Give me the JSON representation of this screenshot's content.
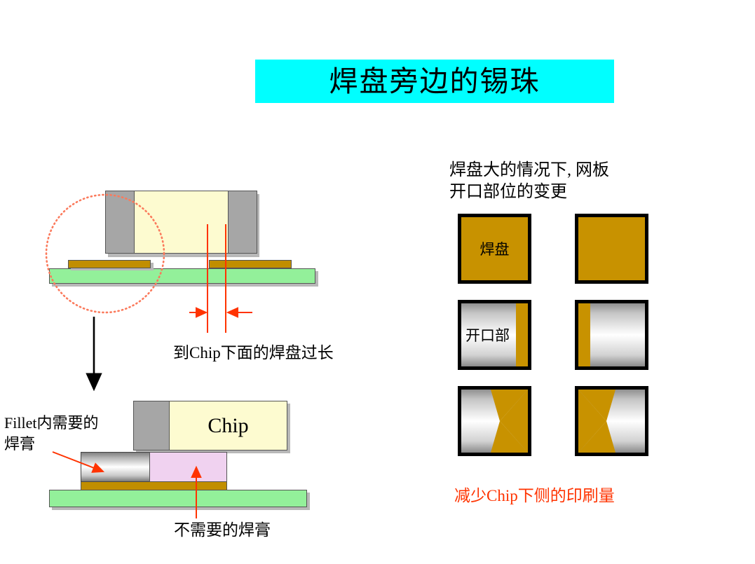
{
  "slide": {
    "title": "焊盘旁边的锡珠",
    "title_bg": "#00ffff"
  },
  "left_panel": {
    "top_diagram": {
      "caption": "到Chip下面的焊盘过长",
      "parts": {
        "chip_body_label": "",
        "pcb_color": "#93f09a",
        "pad_color": "#c18e00",
        "chip_cap_color": "#a6a6a6",
        "chip_core_color": "#fdfbd0",
        "highlight_circle_color": "#ff6347"
      }
    },
    "bottom_diagram": {
      "chip_label": "Chip",
      "fillet_note_line1": "Fillet内需要的",
      "fillet_note_line2": "焊膏",
      "paste_note": "不需要的焊膏",
      "parts": {
        "solder_fillet_color": "#ffffff",
        "unwanted_paste_color": "#f0d2f0",
        "pad_color": "#c18e00",
        "pcb_color": "#93f09a"
      }
    },
    "arrow_color": "#ff3300"
  },
  "right_panel": {
    "heading_line1": "焊盘大的情况下, 网板",
    "heading_line2": "开口部位的变更",
    "conclusion": "减少Chip下侧的印刷量",
    "conclusion_color": "#ff3300",
    "squares": [
      {
        "id": "pad-full-left",
        "label": "焊盘",
        "style": "solid-gold",
        "row": 1,
        "col": 1
      },
      {
        "id": "pad-full-right",
        "label": "",
        "style": "solid-gold",
        "row": 1,
        "col": 2
      },
      {
        "id": "aperture-strip-left",
        "label": "开口部",
        "style": "strip-right",
        "row": 2,
        "col": 1
      },
      {
        "id": "aperture-strip-right",
        "label": "",
        "style": "strip-left",
        "row": 2,
        "col": 2
      },
      {
        "id": "aperture-notch-left",
        "label": "",
        "style": "notch-right",
        "row": 3,
        "col": 1
      },
      {
        "id": "aperture-notch-right",
        "label": "",
        "style": "notch-left",
        "row": 3,
        "col": 2
      }
    ],
    "gold_color": "#c89200"
  }
}
